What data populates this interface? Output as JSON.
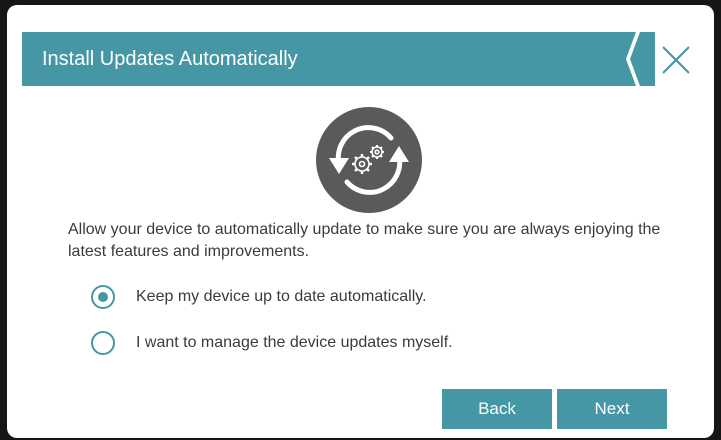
{
  "dialog": {
    "title": "Install Updates Automatically",
    "description": "Allow your device to automatically update to make sure you are always enjoying the latest features and improvements.",
    "options": [
      {
        "label": "Keep my device up to date automatically.",
        "selected": true
      },
      {
        "label": "I want to manage the device updates myself.",
        "selected": false
      }
    ],
    "buttons": {
      "back": "Back",
      "next": "Next"
    }
  },
  "icons": {
    "close": "close-icon",
    "update": "auto-update-gears-icon"
  },
  "colors": {
    "accent": "#4597a6",
    "text": "#3b3b3b",
    "icon_circle": "#5a5a5a",
    "background": "#161616"
  }
}
